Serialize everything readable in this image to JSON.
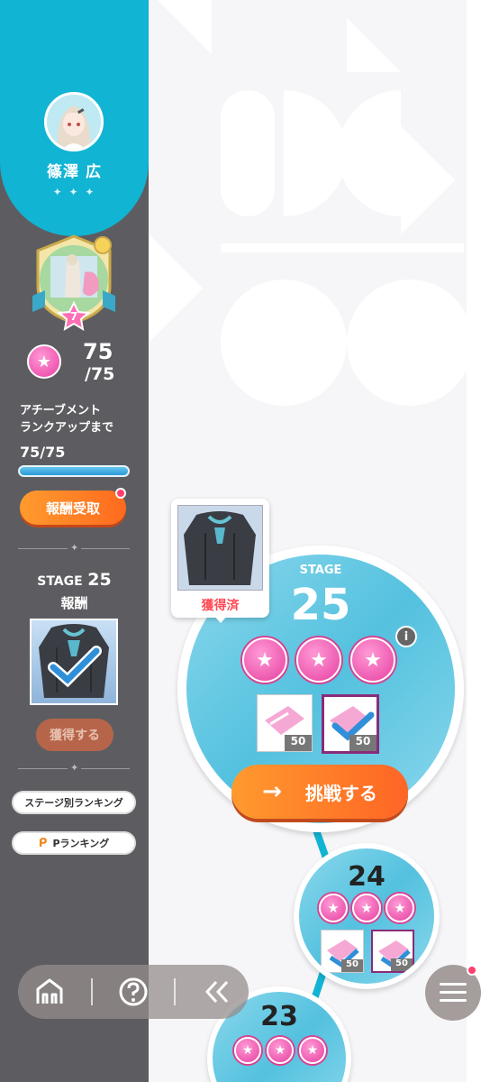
{
  "player": {
    "name": "篠澤 広",
    "sparkle": "✦ ✦ ✦"
  },
  "badge": {
    "level": "7"
  },
  "gems": {
    "count": "75",
    "total": "/75"
  },
  "achievement": {
    "label_line1": "アチーブメント",
    "label_line2": "ランクアップまで",
    "progress_text": "75/75",
    "progress": 1.0
  },
  "buttons": {
    "reward_claim": "報酬受取",
    "obtain": "獲得する",
    "stage_ranking": "ステージ別ランキング",
    "p_ranking": "Pランキング",
    "challenge": "挑戦する"
  },
  "sidebar_stage": {
    "prefix": "STAGE",
    "number": "25",
    "reward_label": "報酬"
  },
  "tooltip": {
    "status": "獲得済"
  },
  "stages": [
    {
      "label": "STAGE",
      "number": "25",
      "item_qty": [
        "50",
        "50"
      ]
    },
    {
      "number": "24",
      "item_qty": [
        "50",
        "50"
      ]
    },
    {
      "number": "23"
    }
  ],
  "colors": {
    "accent": "#12b4d3",
    "sidebar": "#5d5d61",
    "orange": "#ff7a22",
    "pink": "#e63fa0"
  },
  "icons": {
    "nav": [
      "home-icon",
      "help-icon",
      "back-icon"
    ],
    "menu": "menu-icon"
  }
}
